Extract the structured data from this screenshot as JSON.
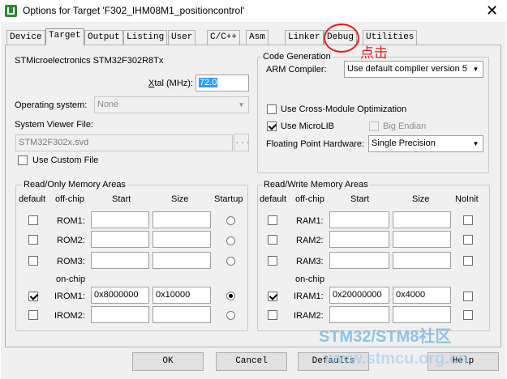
{
  "window": {
    "title": "Options for Target 'F302_IHM08M1_positioncontrol'",
    "close_glyph": "✕"
  },
  "tabs": [
    "Device",
    "Target",
    "Output",
    "Listing",
    "User",
    "C/C++",
    "Asm",
    "Linker",
    "Debug",
    "Utilities"
  ],
  "selected_tab": "Target",
  "annotation": {
    "label": "点击",
    "color": "#e02020"
  },
  "device_name": "STMicroelectronics STM32F302R8Tx",
  "xtal": {
    "label_prefix": "X",
    "label_rest": "tal (MHz):",
    "value": "72.0"
  },
  "os": {
    "label": "Operating system:",
    "value": "None"
  },
  "svd": {
    "label": "System Viewer File:",
    "value": "STM32F302x.svd",
    "browse": "..."
  },
  "custom_file": {
    "label": "Use Custom File",
    "checked": false
  },
  "code_gen": {
    "title": "Code Generation",
    "compiler_label": "ARM Compiler:",
    "compiler_value": "Use default compiler version 5",
    "cross_module": {
      "label": "Use Cross-Module Optimization",
      "checked": false
    },
    "microlib": {
      "label": "Use MicroLIB",
      "checked": true
    },
    "big_endian": {
      "label": "Big Endian",
      "checked": false
    },
    "fp_label": "Floating Point Hardware:",
    "fp_value": "Single Precision"
  },
  "ro_memory": {
    "title": "Read/Only Memory Areas",
    "headers": {
      "default": "default",
      "offchip": "off-chip",
      "start": "Start",
      "size": "Size",
      "startup": "Startup"
    },
    "onchip_label": "on-chip",
    "rows": [
      {
        "name": "ROM1:",
        "start": "",
        "size": "",
        "default": false,
        "startup": false
      },
      {
        "name": "ROM2:",
        "start": "",
        "size": "",
        "default": false,
        "startup": false
      },
      {
        "name": "ROM3:",
        "start": "",
        "size": "",
        "default": false,
        "startup": false
      },
      {
        "name": "IROM1:",
        "start": "0x8000000",
        "size": "0x10000",
        "default": true,
        "startup": true
      },
      {
        "name": "IROM2:",
        "start": "",
        "size": "",
        "default": false,
        "startup": false
      }
    ]
  },
  "rw_memory": {
    "title": "Read/Write Memory Areas",
    "headers": {
      "default": "default",
      "offchip": "off-chip",
      "start": "Start",
      "size": "Size",
      "noinit": "NoInit"
    },
    "onchip_label": "on-chip",
    "rows": [
      {
        "name": "RAM1:",
        "start": "",
        "size": "",
        "default": false,
        "noinit": false
      },
      {
        "name": "RAM2:",
        "start": "",
        "size": "",
        "default": false,
        "noinit": false
      },
      {
        "name": "RAM3:",
        "start": "",
        "size": "",
        "default": false,
        "noinit": false
      },
      {
        "name": "IRAM1:",
        "start": "0x20000000",
        "size": "0x4000",
        "default": true,
        "noinit": false
      },
      {
        "name": "IRAM2:",
        "start": "",
        "size": "",
        "default": false,
        "noinit": false
      }
    ]
  },
  "buttons": {
    "ok": "OK",
    "cancel": "Cancel",
    "defaults": "Defaults",
    "help": "Help"
  },
  "watermark": {
    "line1": "STM32/STM8社区",
    "line2": "www.stmcu.org.cn"
  }
}
